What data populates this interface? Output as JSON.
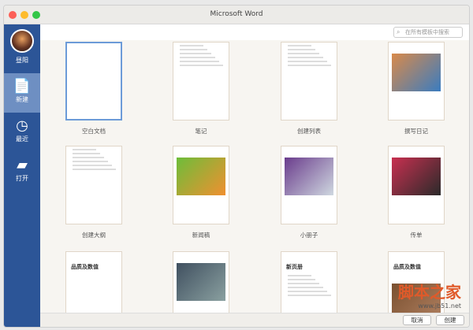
{
  "window": {
    "title": "Microsoft Word"
  },
  "sidebar": {
    "items": [
      {
        "label": "昼阳",
        "icon": "avatar"
      },
      {
        "label": "新建",
        "icon": "new-document-icon"
      },
      {
        "label": "最近",
        "icon": "clock-icon"
      },
      {
        "label": "打开",
        "icon": "folder-icon"
      }
    ]
  },
  "search": {
    "placeholder": "在所有模板中搜索"
  },
  "templates": [
    {
      "label": "空白文档"
    },
    {
      "label": "笔记"
    },
    {
      "label": "创建列表"
    },
    {
      "label": "撰写日记"
    },
    {
      "label": "创建大纲"
    },
    {
      "label": "新闻稿"
    },
    {
      "label": "小册子"
    },
    {
      "label": "传单"
    },
    {
      "label": "品质及数值"
    },
    {
      "label": ""
    },
    {
      "label": "新页册"
    },
    {
      "label": "品质及数值"
    }
  ],
  "buttons": {
    "cancel": "取消",
    "create": "创建"
  },
  "watermark": {
    "text": "脚本之家",
    "url": "www.jb51.net"
  }
}
